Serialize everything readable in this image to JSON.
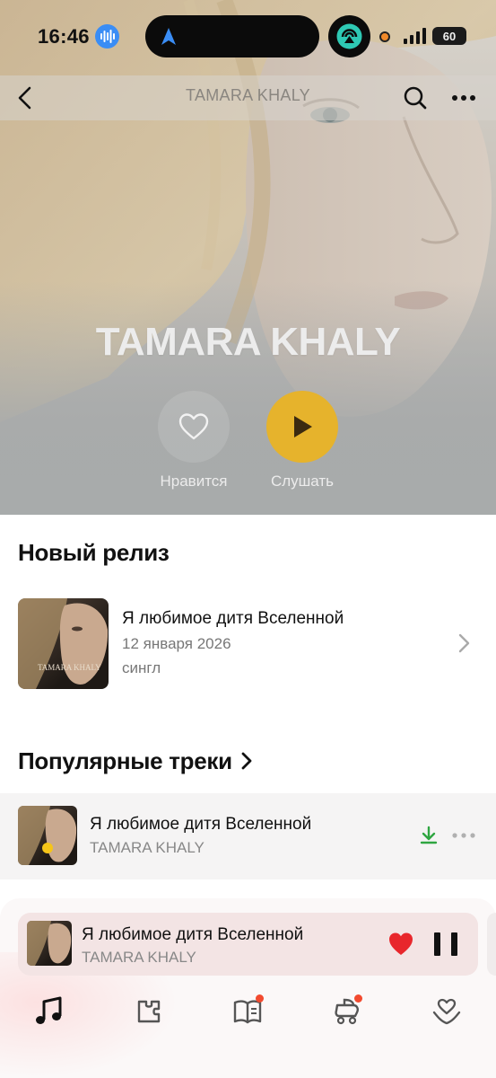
{
  "status": {
    "time": "16:46",
    "battery": "60"
  },
  "header": {
    "title": "TAMARA KHALY"
  },
  "hero": {
    "artist": "TAMARA KHALY",
    "like_label": "Нравится",
    "play_label": "Слушать"
  },
  "new_release": {
    "section_title": "Новый релиз",
    "title": "Я любимое дитя Вселенной",
    "date": "12 января 2026",
    "type": "сингл",
    "cover_text": "TAMARA KHALY"
  },
  "popular": {
    "section_title": "Популярные треки",
    "tracks": [
      {
        "title": "Я любимое дитя Вселенной",
        "artist": "TAMARA KHALY"
      }
    ]
  },
  "mini_player": {
    "title": "Я любимое дитя Вселенной",
    "artist": "TAMARA KHALY"
  },
  "tabs": [
    {
      "name": "music",
      "icon": "music-note-icon",
      "badge": false
    },
    {
      "name": "map",
      "icon": "map-icon",
      "badge": false
    },
    {
      "name": "book",
      "icon": "book-icon",
      "badge": true
    },
    {
      "name": "kids",
      "icon": "stroller-icon",
      "badge": true
    },
    {
      "name": "collection",
      "icon": "heart-hand-icon",
      "badge": false
    }
  ],
  "colors": {
    "accent": "#e6b32c",
    "like": "#e8272c",
    "download": "#2fa641",
    "badge": "#f24a2f"
  }
}
